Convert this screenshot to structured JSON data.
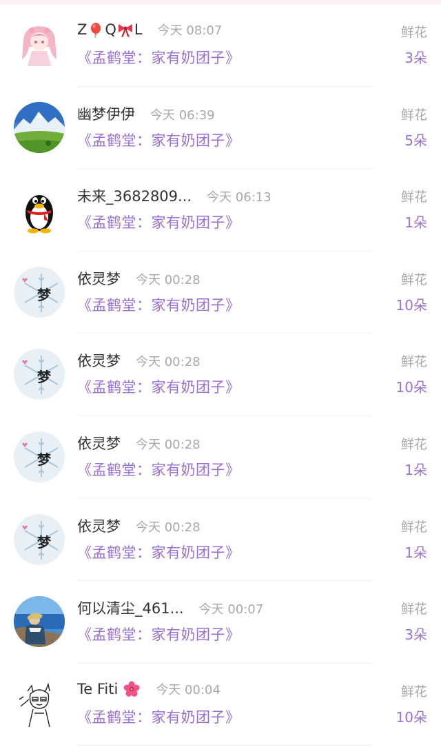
{
  "gift_list": {
    "items": [
      {
        "name": "Z",
        "name_mid": "Q",
        "name_end": "L",
        "time": "今天 08:07",
        "book": "《孟鹤堂：家有奶团子》",
        "gift_type": "鲜花",
        "count": "3朵",
        "avatar": "anime-girl-avatar",
        "emoji": [
          "balloon-emoji",
          "ribbon-emoji"
        ]
      },
      {
        "name": "幽梦伊伊",
        "time": "今天 06:39",
        "book": "《孟鹤堂：家有奶团子》",
        "gift_type": "鲜花",
        "count": "5朵",
        "avatar": "mountain-landscape-avatar"
      },
      {
        "name": "未来_3682809...",
        "time": "今天 06:13",
        "book": "《孟鹤堂：家有奶团子》",
        "gift_type": "鲜花",
        "count": "1朵",
        "avatar": "qq-penguin-avatar"
      },
      {
        "name": "依灵梦",
        "time": "今天 00:28",
        "book": "《孟鹤堂：家有奶团子》",
        "gift_type": "鲜花",
        "count": "10朵",
        "avatar": "snowflake-meng-avatar",
        "avatar_char": "梦"
      },
      {
        "name": "依灵梦",
        "time": "今天 00:28",
        "book": "《孟鹤堂：家有奶团子》",
        "gift_type": "鲜花",
        "count": "10朵",
        "avatar": "snowflake-meng-avatar",
        "avatar_char": "梦"
      },
      {
        "name": "依灵梦",
        "time": "今天 00:28",
        "book": "《孟鹤堂：家有奶团子》",
        "gift_type": "鲜花",
        "count": "1朵",
        "avatar": "snowflake-meng-avatar",
        "avatar_char": "梦"
      },
      {
        "name": "依灵梦",
        "time": "今天 00:28",
        "book": "《孟鹤堂：家有奶团子》",
        "gift_type": "鲜花",
        "count": "1朵",
        "avatar": "snowflake-meng-avatar",
        "avatar_char": "梦"
      },
      {
        "name": "何以清尘_461...",
        "time": "今天 00:07",
        "book": "《孟鹤堂：家有奶团子》",
        "gift_type": "鲜花",
        "count": "3朵",
        "avatar": "seaside-person-avatar"
      },
      {
        "name": "Te Fiti",
        "time": "今天 00:04",
        "book": "《孟鹤堂：家有奶团子》",
        "gift_type": "鲜花",
        "count": "10朵",
        "avatar": "sketch-character-avatar",
        "emoji": [
          "hibiscus-emoji"
        ]
      }
    ]
  },
  "colors": {
    "accent_purple": "#9b6fd3",
    "text_dark": "#333333",
    "text_gray": "#a8a8a8",
    "divider": "#efefef"
  }
}
